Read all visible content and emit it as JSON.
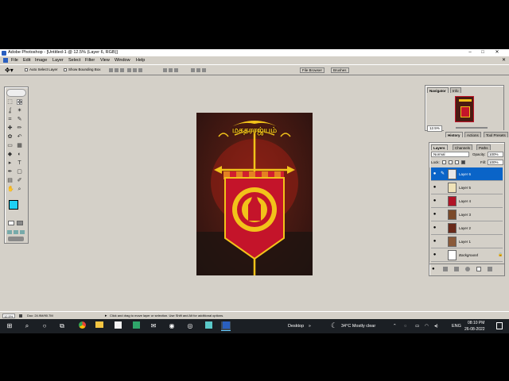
{
  "window": {
    "title": "Adobe Photoshop - [Untitled-1 @ 12.5% (Layer 6, RGB)]",
    "minimize": "–",
    "maximize": "□",
    "close": "✕"
  },
  "menu": [
    "File",
    "Edit",
    "Image",
    "Layer",
    "Select",
    "Filter",
    "View",
    "Window",
    "Help"
  ],
  "options": {
    "auto_select": "Auto Select Layer",
    "bounding_box": "Show Bounding Box",
    "file_browser_tab": "File Browser",
    "brushes_tab": "Brushes"
  },
  "canvas": {
    "title_text": "மகதராஜ்யம்",
    "colors": {
      "banner": "#c4142a",
      "gold": "#f2c21a",
      "bg": "#3a1812"
    }
  },
  "navigator": {
    "tabs": [
      "Navigator",
      "Info"
    ],
    "zoom": "12.5%"
  },
  "history_tabs": [
    "History",
    "Actions",
    "Tool Presets"
  ],
  "layers": {
    "tabs": [
      "Layers",
      "Channels",
      "Paths"
    ],
    "blend_mode": "Normal",
    "opacity_label": "Opacity:",
    "opacity": "100%",
    "lock_label": "Lock:",
    "fill_label": "Fill:",
    "fill": "100%",
    "rows": [
      {
        "name": "Layer 6",
        "selected": true
      },
      {
        "name": "Layer 5",
        "selected": false
      },
      {
        "name": "Layer 4",
        "selected": false
      },
      {
        "name": "Layer 3",
        "selected": false
      },
      {
        "name": "Layer 2",
        "selected": false
      },
      {
        "name": "Layer 1",
        "selected": false
      },
      {
        "name": "Background",
        "selected": false
      }
    ]
  },
  "status": {
    "zoom": "12.5%",
    "doc": "Doc: 24.9M/90.7M",
    "hint": "Click and drag to move layer or selection. Use Shift and Alt for additional options."
  },
  "taskbar": {
    "desktop": "Desktop",
    "weather": "34°C  Mostly clear",
    "lang": "ENG",
    "time": "08:10 PM",
    "date": "26-08-2022"
  }
}
